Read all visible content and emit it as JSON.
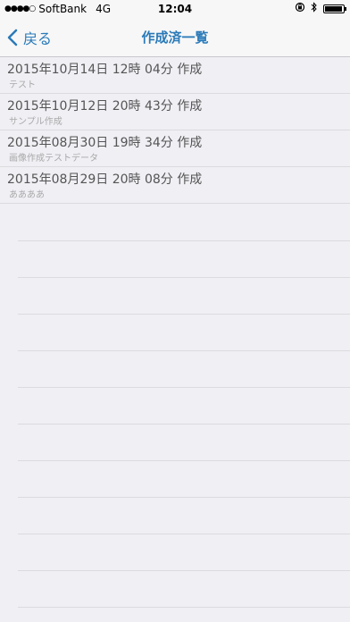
{
  "status_bar": {
    "carrier": "SoftBank",
    "network": "4G",
    "time": "12:04",
    "signal_dots": "●●●●○",
    "battery_level": 0.95
  },
  "nav": {
    "back_label": "戻る",
    "title": "作成済一覧"
  },
  "list": {
    "items": [
      {
        "title": "2015年10月14日 12時 04分 作成",
        "subtitle": "テスト"
      },
      {
        "title": "2015年10月12日 20時 43分 作成",
        "subtitle": "サンプル作成"
      },
      {
        "title": "2015年08月30日 19時 34分 作成",
        "subtitle": "画像作成テストデータ"
      },
      {
        "title": "2015年08月29日 20時 08分 作成",
        "subtitle": "ああああ"
      }
    ]
  },
  "colors": {
    "accent": "#2a7ab8",
    "background": "#efeff4",
    "separator": "#dcdcdf"
  }
}
